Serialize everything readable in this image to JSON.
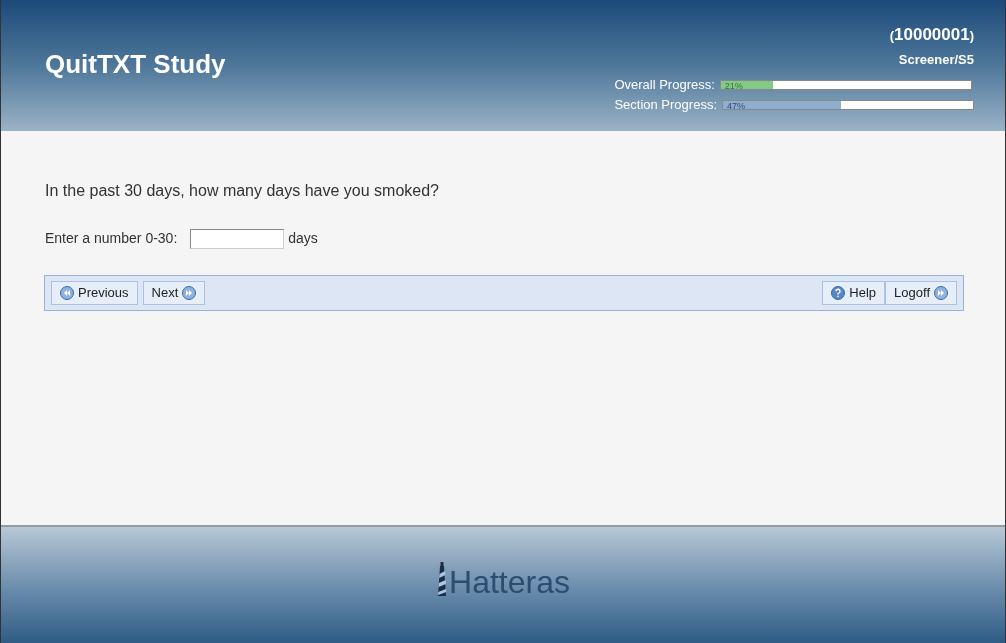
{
  "header": {
    "title": "QuitTXT Study",
    "participant_id": "10000001",
    "open_paren": "(",
    "close_paren": ")",
    "location": "Screener/S5",
    "progress": [
      {
        "label": "Overall Progress:",
        "level": 0.21,
        "reading": "21%",
        "kind": "overall"
      },
      {
        "label": "Section Progress:",
        "level": 0.47,
        "reading": "47%",
        "kind": "section"
      }
    ]
  },
  "question": "In the past 30 days, how many days have you smoked?",
  "answer": {
    "label": "Enter a number 0-30:",
    "unit": "days"
  },
  "nav": {
    "left": [
      {
        "label": "Previous",
        "kind": "back"
      },
      {
        "label": "Next",
        "kind": "forward"
      }
    ],
    "right": [
      {
        "label": "Help",
        "kind": "help"
      },
      {
        "label": "Logoff",
        "kind": "forward"
      }
    ]
  },
  "footer": {
    "logo": "Hatteras"
  }
}
